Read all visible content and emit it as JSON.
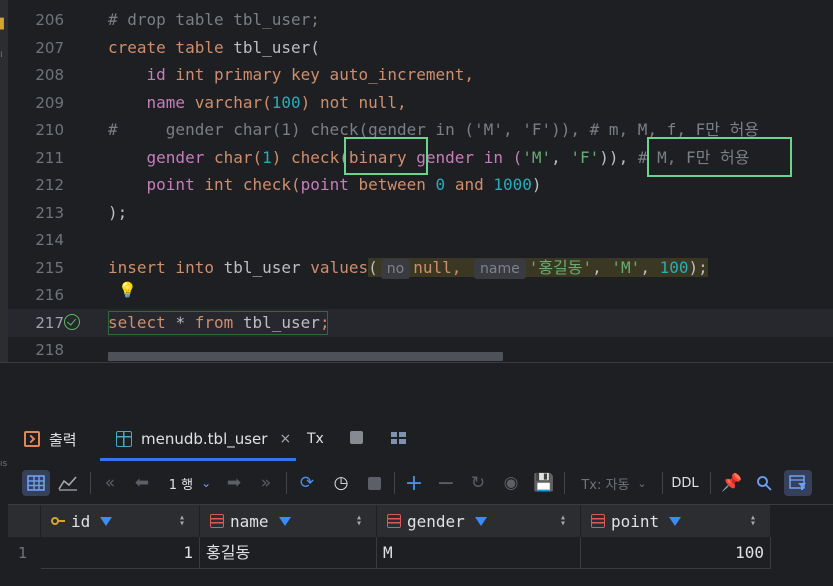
{
  "editor": {
    "line_numbers": [
      "206",
      "207",
      "208",
      "209",
      "210",
      "211",
      "212",
      "213",
      "214",
      "215",
      "216",
      "217",
      "218"
    ],
    "lines": {
      "l206": "# drop table tbl_user;",
      "l207_kw": "create table ",
      "l207_rest": "tbl_user(",
      "l208_col": "id",
      "l208_rest": " int primary key auto_increment,",
      "l209_col": "name",
      "l209_type": " varchar(",
      "l209_num": "100",
      "l209_rest": ") not null,",
      "l210": "#     gender char(1) check(gender in ('M', 'F')), # m, M, f, F만 허용",
      "l211_col": "gender",
      "l211_type": " char(",
      "l211_num": "1",
      "l211_a": ") check(",
      "l211_bin": "binary",
      "l211_b": " gender in (",
      "l211_m": "'M'",
      "l211_c": ", ",
      "l211_f": "'F'",
      "l211_d": ")), ",
      "l211_cm": "# M, F만 허용",
      "l212_col": "point",
      "l212_a": " int check(",
      "l212_col2": "point",
      "l212_b": " between ",
      "l212_n0": "0",
      "l212_c": " and ",
      "l212_n1": "1000",
      "l212_d": ")",
      "l213": ");",
      "l215_kw": "insert into ",
      "l215_tbl": "tbl_user ",
      "l215_kw2": "values",
      "l215_open": "(",
      "l215_hint_no": "no",
      "l215_null": "null,",
      "l215_hint_name": "name",
      "l215_s1": "'홍길동'",
      "l215_comma": ", ",
      "l215_s2": "'M'",
      "l215_comma2": ", ",
      "l215_num": "100",
      "l215_close": ");",
      "l217_kw": "select ",
      "l217_star": "* ",
      "l217_kw2": "from ",
      "l217_tbl": "tbl_user",
      "l217_end": ";"
    }
  },
  "tool_window": {
    "tabs": {
      "output": "출력",
      "table": "menudb.tbl_user",
      "close": "×",
      "tx": "Tx"
    },
    "toolbar": {
      "page_label": "1 행",
      "tx_mode": "Tx: 자동",
      "ddl": "DDL"
    },
    "grid": {
      "columns": [
        "id",
        "name",
        "gender",
        "point"
      ],
      "rows": [
        {
          "row_num": "1",
          "id": "1",
          "name": "홍길동",
          "gender": "M",
          "point": "100"
        }
      ]
    }
  },
  "colors": {
    "accent": "#3574f0",
    "highlight_box": "#6bd48c",
    "keyword": "#cf8e6d",
    "string": "#6aab73",
    "number": "#2aacb8",
    "comment": "#7a7e85",
    "column": "#c77dbb"
  },
  "icons": {
    "run_status": "check-circle-icon",
    "intention": "lightbulb-icon"
  }
}
